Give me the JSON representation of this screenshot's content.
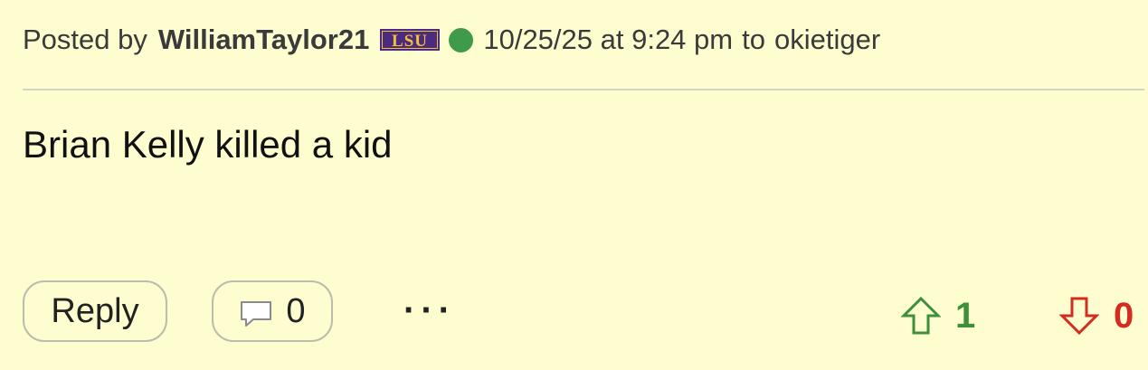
{
  "header": {
    "posted_by_label": "Posted by",
    "username": "WilliamTaylor21",
    "team_logo_text": "LSU",
    "timestamp": "10/25/25 at 9:24 pm",
    "to_label": "to",
    "reply_to_user": "okietiger"
  },
  "post": {
    "body": "Brian Kelly killed a kid"
  },
  "actions": {
    "reply_label": "Reply",
    "comment_count": "0",
    "more_label": "···",
    "upvote_count": "1",
    "downvote_count": "0"
  },
  "colors": {
    "background": "#fdfdd0",
    "online_status": "#3f9a4c",
    "upvote": "#3e8f3a",
    "downvote": "#d42c20",
    "lsu_purple": "#4b2a82",
    "lsu_gold": "#f2c230"
  }
}
